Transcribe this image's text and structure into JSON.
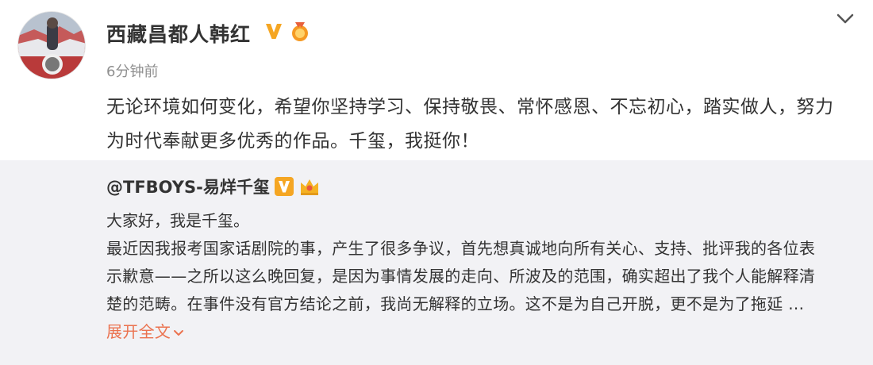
{
  "post": {
    "author": "西藏昌都人韩红",
    "time": "6分钟前",
    "text": "无论环境如何变化，希望你坚持学习、保持敬畏、常怀感恩、不忘初心，踏实做人，努力为时代奉献更多优秀的作品。千玺，我挺你！",
    "badges": [
      "verified-v-icon",
      "gold-medal-icon"
    ]
  },
  "repost": {
    "author": "@TFBOYS-易烊千玺",
    "greeting": "大家好，我是千玺。",
    "text": "最近因我报考国家话剧院的事，产生了很多争议，首先想真诚地向所有关心、支持、批评我的各位表示歉意——之所以这么晚回复，是因为事情发展的走向、所波及的范围，确实超出了我个人能解释清楚的范畴。在事件没有官方结论之前，我尚无解释的立场。这不是为自己开脱，更不是为了拖延 ...",
    "expand_label": "展开全文",
    "badges": [
      "verified-v-icon",
      "crown-icon"
    ]
  },
  "colors": {
    "link": "#eb7350",
    "badge_gold": "#f5a623",
    "repost_bg": "#f2f2f5"
  }
}
